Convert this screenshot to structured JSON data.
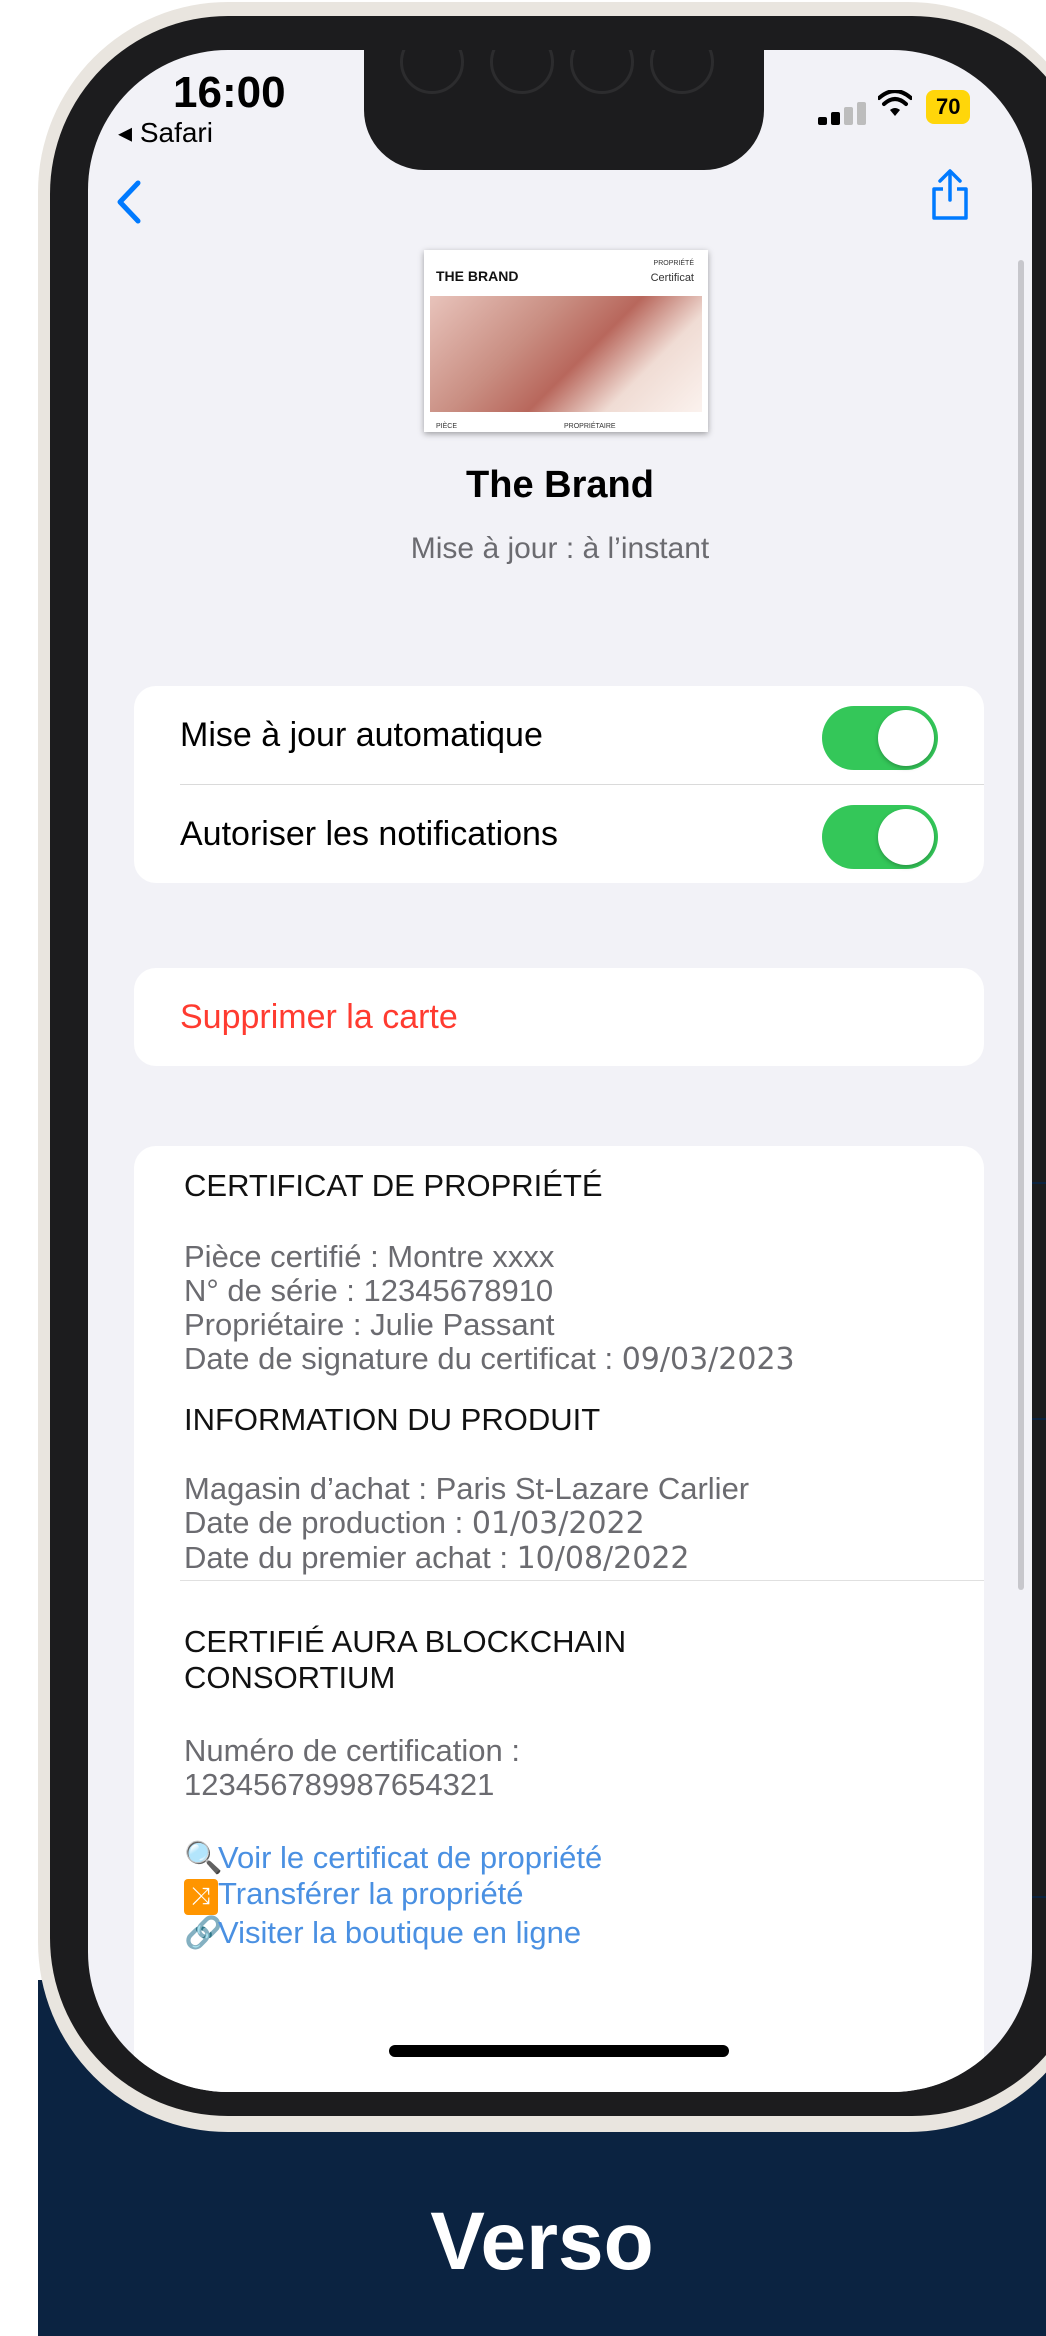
{
  "status_bar": {
    "time": "16:00",
    "back_app": "◂ Safari",
    "battery": "70"
  },
  "card": {
    "thumb_logo": "THE BRAND",
    "thumb_kind_small": "PROPRIÉTÉ",
    "thumb_kind": "Certificat",
    "thumb_footer_left": "PIÈCE",
    "thumb_footer_right": "PROPRIÉTAIRE",
    "title": "The Brand",
    "updated": "Mise à jour : à l’instant"
  },
  "settings": {
    "auto_update": "Mise à jour automatique",
    "notifications": "Autoriser les notifications",
    "delete": "Supprimer la carte"
  },
  "details": {
    "ownership_heading": "CERTIFICAT DE PROPRIÉTÉ",
    "piece": "Pièce certifié : Montre xxxx",
    "serial": "N° de série : 12345678910",
    "owner": "Propriétaire : Julie Passant",
    "signature_label": "Date de signature du certificat :",
    "signature_date": "09/03/2023",
    "product_heading": "INFORMATION DU PRODUIT",
    "store": "Magasin d’achat : Paris St-Lazare Carlier",
    "production_label": "Date de production :",
    "production_date": "01/03/2022",
    "first_purchase_label": "Date du premier achat :",
    "first_purchase_date": "10/08/2022",
    "aura_heading_1": "CERTIFIÉ AURA BLOCKCHAIN",
    "aura_heading_2": "CONSORTIUM",
    "cert_number_label": "Numéro de certification :",
    "cert_number": "123456789987654321"
  },
  "links": {
    "view": "Voir le certificat de propriété",
    "transfer": "Transférer la propriété",
    "shop": "Visiter la boutique en ligne"
  },
  "icons": {
    "view": "magnifier-icon",
    "transfer": "shuffle-icon",
    "shop": "link-icon"
  },
  "colors": {
    "toggle_on": "#34c759",
    "delete": "#ff3b30",
    "link": "#4a90e2",
    "band": "#0b2341"
  },
  "toggles": {
    "auto_update": true,
    "notifications": true
  },
  "caption": "Verso"
}
